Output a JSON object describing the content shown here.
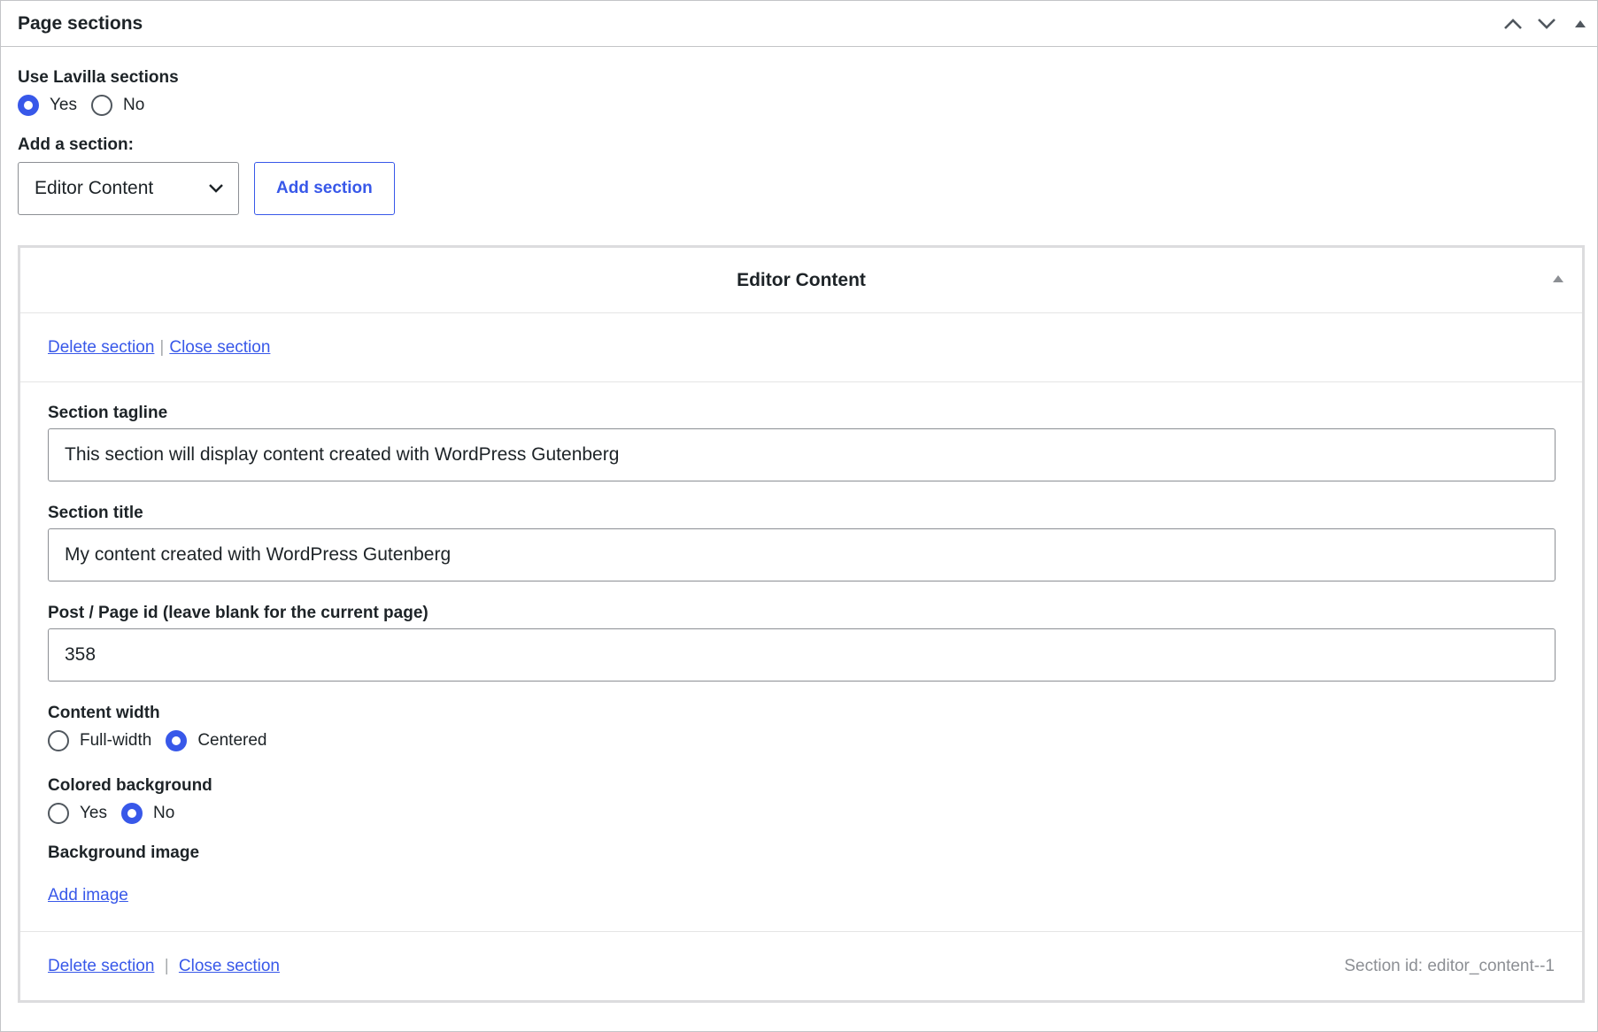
{
  "postbox": {
    "title": "Page sections",
    "move_up_label": "Move up",
    "move_down_label": "Move down",
    "toggle_label": "Toggle panel"
  },
  "use_sections": {
    "label": "Use Lavilla sections",
    "options": [
      {
        "label": "Yes",
        "checked": true
      },
      {
        "label": "No",
        "checked": false
      }
    ]
  },
  "add_section": {
    "label": "Add a section:",
    "selected": "Editor Content",
    "button_label": "Add section"
  },
  "section": {
    "title": "Editor Content",
    "delete_label": "Delete section",
    "close_label": "Close section",
    "separator": "|",
    "tagline": {
      "label": "Section tagline",
      "value": "This section will display content created with WordPress Gutenberg"
    },
    "section_title": {
      "label": "Section title",
      "value": "My content created with WordPress Gutenberg"
    },
    "post_id": {
      "label": "Post / Page id (leave blank for the current page)",
      "value": "358"
    },
    "content_width": {
      "label": "Content width",
      "options": [
        {
          "label": "Full-width",
          "checked": false
        },
        {
          "label": "Centered",
          "checked": true
        }
      ]
    },
    "colored_background": {
      "label": "Colored background",
      "options": [
        {
          "label": "Yes",
          "checked": false
        },
        {
          "label": "No",
          "checked": true
        }
      ]
    },
    "background_image": {
      "label": "Background image",
      "add_label": "Add image"
    },
    "section_id_text": "Section id: editor_content--1"
  },
  "colors": {
    "accent": "#3858e9",
    "border": "#c3c4c7",
    "text": "#1d2327",
    "muted": "#8c8f94"
  }
}
